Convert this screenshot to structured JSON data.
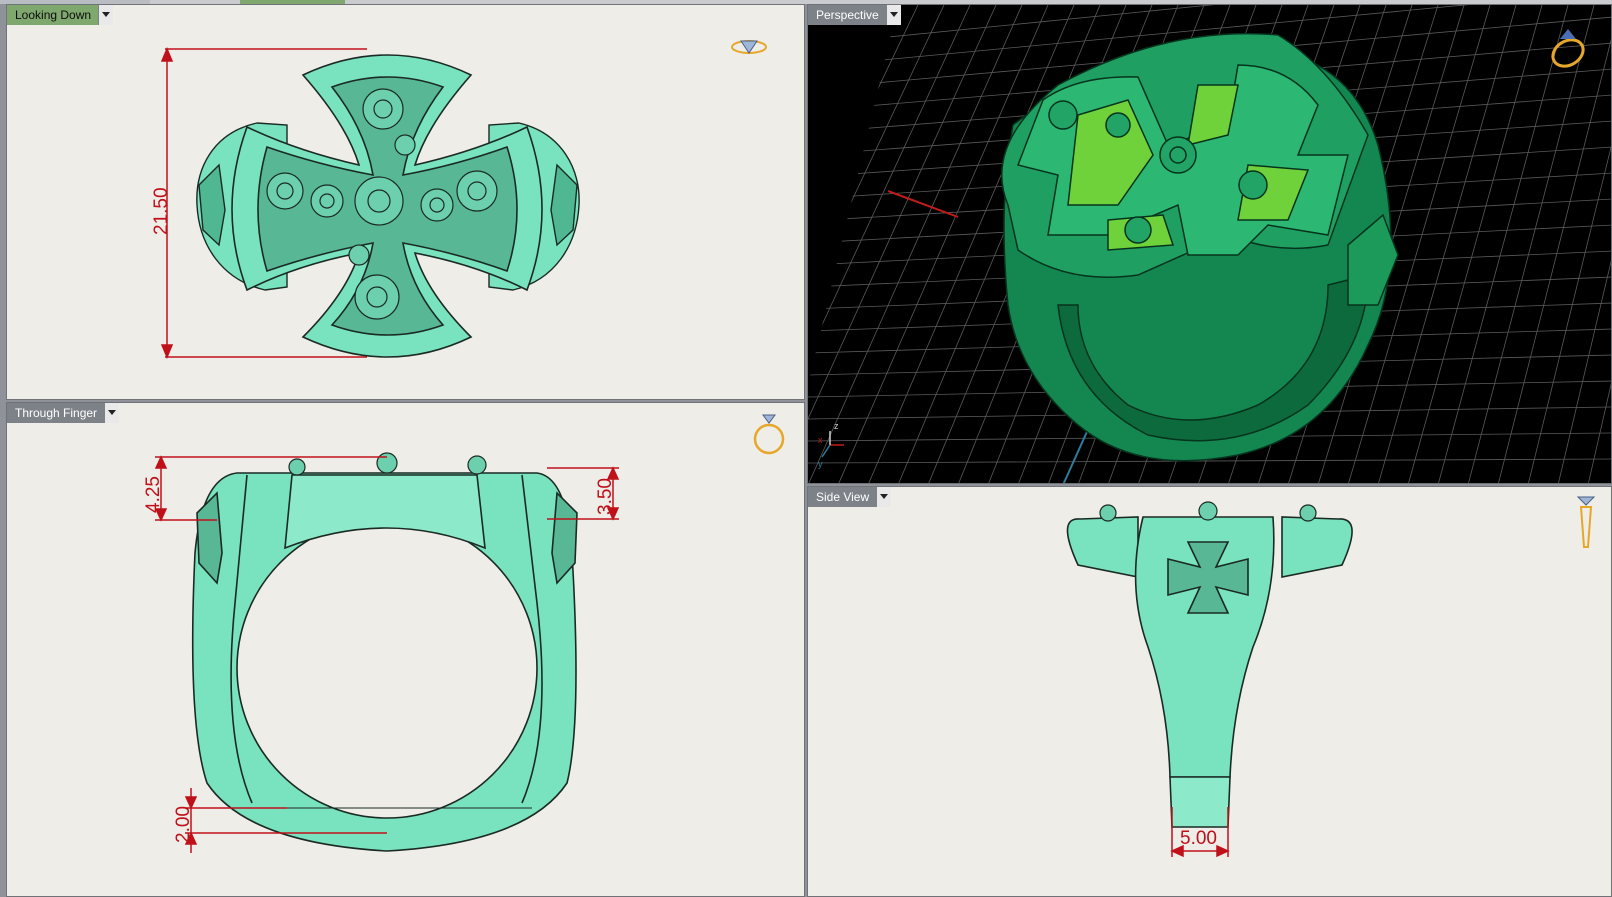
{
  "viewports": {
    "top": {
      "label": "Looking Down",
      "dimension": "21.50",
      "icon": "ring-gem-top-icon"
    },
    "perspective": {
      "label": "Perspective",
      "icon": "ring-orbit-icon",
      "axes": {
        "x": "x",
        "y": "y",
        "z": "z"
      }
    },
    "front": {
      "label": "Through Finger",
      "dim_top_left": "4.25",
      "dim_top_right": "3.50",
      "dim_bottom": "2.00",
      "icon": "ring-front-icon"
    },
    "side": {
      "label": "Side View",
      "dim_bottom": "5.00",
      "icon": "ring-side-icon"
    }
  },
  "colors": {
    "model_light": "#79e2bf",
    "model_dark": "#13874f",
    "dimension": "#c0101a",
    "active_label": "#7fa86f",
    "label_bg": "#7d8288"
  }
}
